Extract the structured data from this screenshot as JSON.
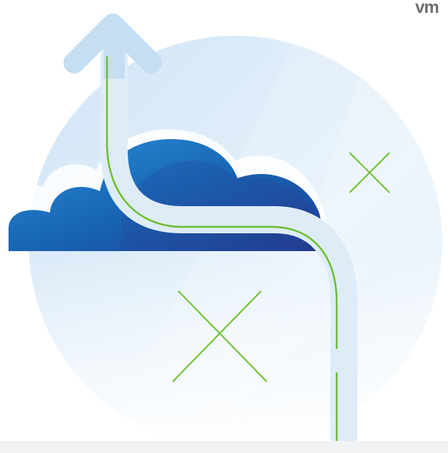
{
  "brand": {
    "logo_text": "vm"
  },
  "colors": {
    "background": "#ffffff",
    "circle_light": "#e6f1fa",
    "cloud_dark": "#1f3f93",
    "cloud_mid": "#1262b3",
    "cloud_light": "#2f8bd1",
    "path_pale": "#ddebf8",
    "arrow": "#cbe2f3",
    "green_line": "#6bbf2e",
    "bottom_bar": "#f1f2f3"
  },
  "icons": [
    "arrow-up-icon",
    "cloud-icon",
    "x-mark-icon"
  ]
}
